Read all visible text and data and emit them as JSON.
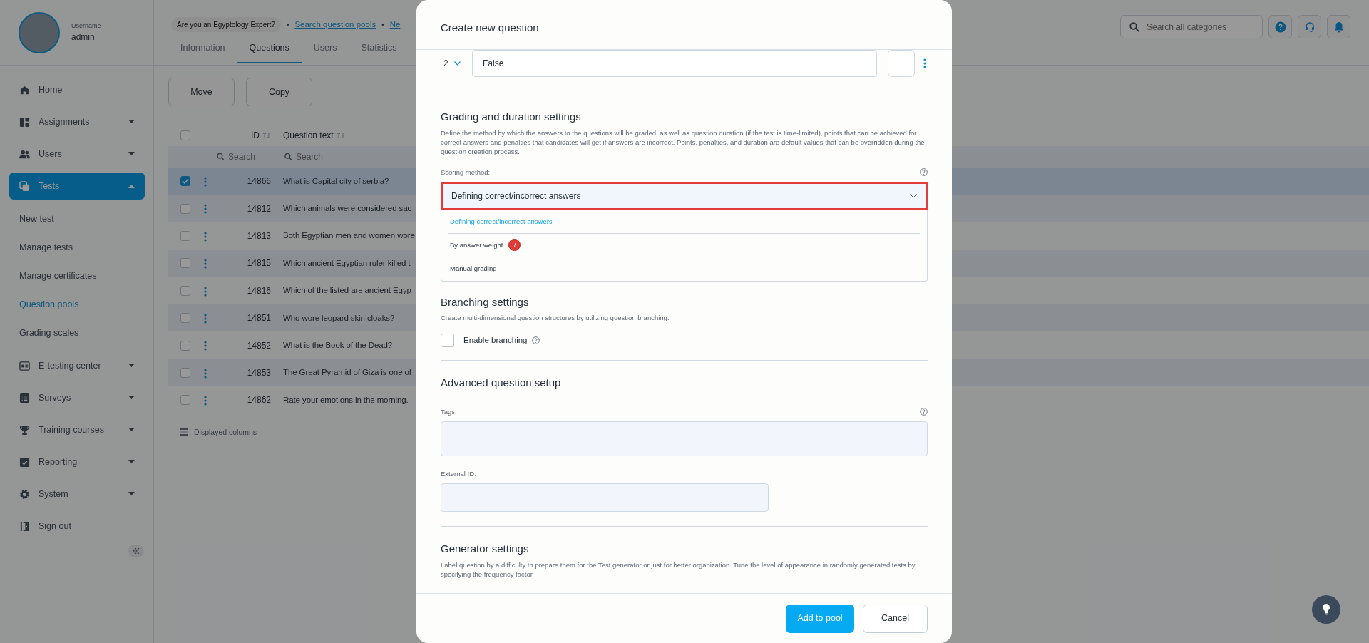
{
  "user": {
    "label": "Username",
    "name": "admin"
  },
  "sidebar": {
    "items": [
      {
        "label": "Home",
        "selected": false
      },
      {
        "label": "Assignments",
        "selected": false,
        "expanded": false
      },
      {
        "label": "Users",
        "selected": false,
        "expanded": false
      },
      {
        "label": "Tests",
        "selected": true,
        "expanded": true,
        "children": [
          {
            "label": "New test",
            "selected": false
          },
          {
            "label": "Manage tests",
            "selected": false
          },
          {
            "label": "Manage certificates",
            "selected": false
          },
          {
            "label": "Question pools",
            "selected": true
          },
          {
            "label": "Grading scales",
            "selected": false
          }
        ]
      },
      {
        "label": "E-testing center",
        "selected": false,
        "expanded": false
      },
      {
        "label": "Surveys",
        "selected": false,
        "expanded": false
      },
      {
        "label": "Training courses",
        "selected": false,
        "expanded": false
      },
      {
        "label": "Reporting",
        "selected": false,
        "expanded": false
      },
      {
        "label": "System",
        "selected": false,
        "expanded": false
      },
      {
        "label": "Sign out",
        "selected": false
      }
    ]
  },
  "header": {
    "pool_badge": "Are you an Egyptology Expert?",
    "separator": "•",
    "links": [
      "Search question pools",
      "Ne"
    ],
    "tabs": [
      {
        "label": "Information",
        "selected": false
      },
      {
        "label": "Questions",
        "selected": true
      },
      {
        "label": "Users",
        "selected": false
      },
      {
        "label": "Statistics",
        "selected": false
      }
    ],
    "search": {
      "placeholder": "Search all categories"
    }
  },
  "toolbar": [
    "Move",
    "Copy"
  ],
  "table": {
    "columns": [
      "ID",
      "Question text"
    ],
    "all_selected": false,
    "filters": [
      {
        "placeholder": "Search"
      },
      {
        "placeholder": "Search"
      }
    ],
    "rows": [
      {
        "id": "14866",
        "text": "What is Capital city of serbia?",
        "checked": true
      },
      {
        "id": "14812",
        "text": "Which animals were considered sac",
        "checked": false
      },
      {
        "id": "14813",
        "text": "Both Egyptian men and women wore",
        "checked": false
      },
      {
        "id": "14815",
        "text": "Which ancient Egyptian ruler killed t",
        "checked": false
      },
      {
        "id": "14816",
        "text": "Which of the listed are ancient Egyp",
        "checked": false
      },
      {
        "id": "14851",
        "text": "Who wore leopard skin cloaks?",
        "checked": false
      },
      {
        "id": "14852",
        "text": "What is the Book of the Dead?",
        "checked": false
      },
      {
        "id": "14853",
        "text": "The Great Pyramid of Giza is one of",
        "checked": false
      },
      {
        "id": "14862",
        "text": "Rate your emotions in the morning.",
        "checked": false
      }
    ],
    "footer": "Displayed columns"
  },
  "modal": {
    "title": "Create new question",
    "answer": {
      "number": "2",
      "value": "False"
    },
    "grading": {
      "title": "Grading and duration settings",
      "description": "Define the method by which the answers to the questions will be graded, as well as question duration (if the test is time-limited), points that can be achieved for correct answers and penalties that candidates will get if answers are incorrect. Points, penalties, and duration are default values that can be overridden during the question creation process.",
      "scoring": {
        "label": "Scoring method:",
        "value": "Defining correct/incorrect answers",
        "expanded": true,
        "options": [
          {
            "label": "Defining correct/incorrect answers",
            "selected": true
          },
          {
            "label": "By answer weight",
            "selected": false,
            "step_badge": "7"
          },
          {
            "label": "Manual grading",
            "selected": false
          }
        ]
      }
    },
    "branching": {
      "title": "Branching settings",
      "description": "Create multi-dimensional question structures by utilizing question branching.",
      "checkbox": {
        "label": "Enable branching",
        "checked": false
      }
    },
    "advanced": {
      "title": "Advanced question setup",
      "fields": [
        {
          "label": "Tags:",
          "kind": "wide"
        },
        {
          "label": "External ID:",
          "kind": "narrow"
        }
      ]
    },
    "generator": {
      "title": "Generator settings",
      "description": "Label question by a difficulty to prepare them for the Test generator or just for better organization. Tune the level of appearance in randomly generated tests by specifying the frequency factor."
    },
    "buttons": [
      {
        "label": "Add to pool",
        "kind": "primary"
      },
      {
        "label": "Cancel",
        "kind": "secondary"
      }
    ]
  }
}
